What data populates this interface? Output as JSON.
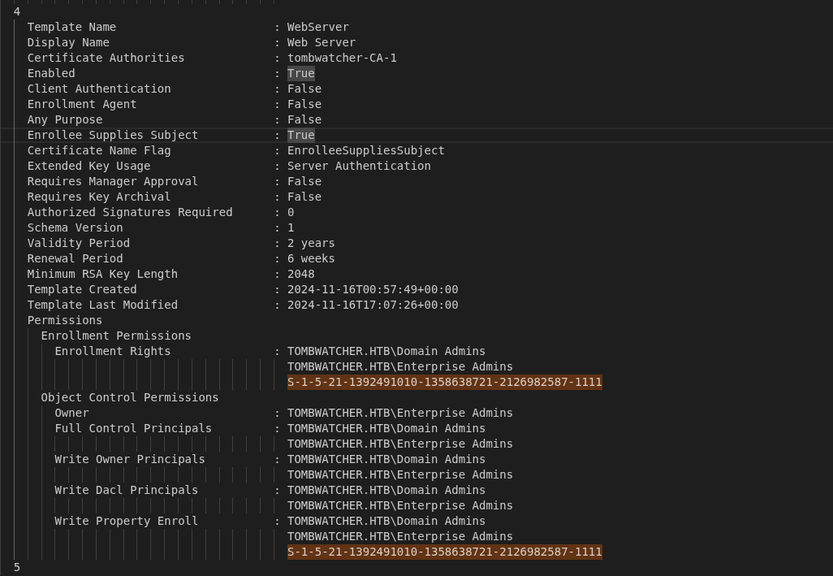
{
  "templates": [
    {
      "number": "4",
      "properties": [
        {
          "name": "Template Name",
          "separator": ":",
          "current_line": false,
          "values": [
            {
              "text": "WebServer",
              "occurrence_highlight": false,
              "search_match": false
            }
          ]
        },
        {
          "name": "Display Name",
          "separator": ":",
          "current_line": false,
          "values": [
            {
              "text": "Web Server",
              "occurrence_highlight": false,
              "search_match": false
            }
          ]
        },
        {
          "name": "Certificate Authorities",
          "separator": ":",
          "current_line": false,
          "values": [
            {
              "text": "tombwatcher-CA-1",
              "occurrence_highlight": false,
              "search_match": false
            }
          ]
        },
        {
          "name": "Enabled",
          "separator": ":",
          "current_line": false,
          "values": [
            {
              "text": "True",
              "occurrence_highlight": true,
              "search_match": false
            }
          ]
        },
        {
          "name": "Client Authentication",
          "separator": ":",
          "current_line": false,
          "values": [
            {
              "text": "False",
              "occurrence_highlight": false,
              "search_match": false
            }
          ]
        },
        {
          "name": "Enrollment Agent",
          "separator": ":",
          "current_line": false,
          "values": [
            {
              "text": "False",
              "occurrence_highlight": false,
              "search_match": false
            }
          ]
        },
        {
          "name": "Any Purpose",
          "separator": ":",
          "current_line": false,
          "values": [
            {
              "text": "False",
              "occurrence_highlight": false,
              "search_match": false
            }
          ]
        },
        {
          "name": "Enrollee Supplies Subject",
          "separator": ":",
          "current_line": true,
          "values": [
            {
              "text": "True",
              "occurrence_highlight": true,
              "search_match": false
            }
          ]
        },
        {
          "name": "Certificate Name Flag",
          "separator": ":",
          "current_line": false,
          "values": [
            {
              "text": "EnrolleeSuppliesSubject",
              "occurrence_highlight": false,
              "search_match": false
            }
          ]
        },
        {
          "name": "Extended Key Usage",
          "separator": ":",
          "current_line": false,
          "values": [
            {
              "text": "Server Authentication",
              "occurrence_highlight": false,
              "search_match": false
            }
          ]
        },
        {
          "name": "Requires Manager Approval",
          "separator": ":",
          "current_line": false,
          "values": [
            {
              "text": "False",
              "occurrence_highlight": false,
              "search_match": false
            }
          ]
        },
        {
          "name": "Requires Key Archival",
          "separator": ":",
          "current_line": false,
          "values": [
            {
              "text": "False",
              "occurrence_highlight": false,
              "search_match": false
            }
          ]
        },
        {
          "name": "Authorized Signatures Required",
          "separator": ":",
          "current_line": false,
          "values": [
            {
              "text": "0",
              "occurrence_highlight": false,
              "search_match": false
            }
          ]
        },
        {
          "name": "Schema Version",
          "separator": ":",
          "current_line": false,
          "values": [
            {
              "text": "1",
              "occurrence_highlight": false,
              "search_match": false
            }
          ]
        },
        {
          "name": "Validity Period",
          "separator": ":",
          "current_line": false,
          "values": [
            {
              "text": "2 years",
              "occurrence_highlight": false,
              "search_match": false
            }
          ]
        },
        {
          "name": "Renewal Period",
          "separator": ":",
          "current_line": false,
          "values": [
            {
              "text": "6 weeks",
              "occurrence_highlight": false,
              "search_match": false
            }
          ]
        },
        {
          "name": "Minimum RSA Key Length",
          "separator": ":",
          "current_line": false,
          "values": [
            {
              "text": "2048",
              "occurrence_highlight": false,
              "search_match": false
            }
          ]
        },
        {
          "name": "Template Created",
          "separator": ":",
          "current_line": false,
          "values": [
            {
              "text": "2024-11-16T00:57:49+00:00",
              "occurrence_highlight": false,
              "search_match": false
            }
          ]
        },
        {
          "name": "Template Last Modified",
          "separator": ":",
          "current_line": false,
          "values": [
            {
              "text": "2024-11-16T17:07:26+00:00",
              "occurrence_highlight": false,
              "search_match": false
            }
          ]
        },
        {
          "name": "Permissions",
          "current_line": false,
          "children": [
            {
              "name": "Enrollment Permissions",
              "current_line": false,
              "children": [
                {
                  "name": "Enrollment Rights",
                  "separator": ":",
                  "current_line": false,
                  "values": [
                    {
                      "text": "TOMBWATCHER.HTB\\Domain Admins",
                      "occurrence_highlight": false,
                      "search_match": false
                    },
                    {
                      "text": "TOMBWATCHER.HTB\\Enterprise Admins",
                      "occurrence_highlight": false,
                      "search_match": false
                    },
                    {
                      "text": "S-1-5-21-1392491010-1358638721-2126982587-1111",
                      "occurrence_highlight": false,
                      "search_match": true
                    }
                  ]
                }
              ]
            },
            {
              "name": "Object Control Permissions",
              "current_line": false,
              "children": [
                {
                  "name": "Owner",
                  "separator": ":",
                  "current_line": false,
                  "values": [
                    {
                      "text": "TOMBWATCHER.HTB\\Enterprise Admins",
                      "occurrence_highlight": false,
                      "search_match": false
                    }
                  ]
                },
                {
                  "name": "Full Control Principals",
                  "separator": ":",
                  "current_line": false,
                  "values": [
                    {
                      "text": "TOMBWATCHER.HTB\\Domain Admins",
                      "occurrence_highlight": false,
                      "search_match": false
                    },
                    {
                      "text": "TOMBWATCHER.HTB\\Enterprise Admins",
                      "occurrence_highlight": false,
                      "search_match": false
                    }
                  ]
                },
                {
                  "name": "Write Owner Principals",
                  "separator": ":",
                  "current_line": false,
                  "values": [
                    {
                      "text": "TOMBWATCHER.HTB\\Domain Admins",
                      "occurrence_highlight": false,
                      "search_match": false
                    },
                    {
                      "text": "TOMBWATCHER.HTB\\Enterprise Admins",
                      "occurrence_highlight": false,
                      "search_match": false
                    }
                  ]
                },
                {
                  "name": "Write Dacl Principals",
                  "separator": ":",
                  "current_line": false,
                  "values": [
                    {
                      "text": "TOMBWATCHER.HTB\\Domain Admins",
                      "occurrence_highlight": false,
                      "search_match": false
                    },
                    {
                      "text": "TOMBWATCHER.HTB\\Enterprise Admins",
                      "occurrence_highlight": false,
                      "search_match": false
                    }
                  ]
                },
                {
                  "name": "Write Property Enroll",
                  "separator": ":",
                  "current_line": false,
                  "values": [
                    {
                      "text": "TOMBWATCHER.HTB\\Domain Admins",
                      "occurrence_highlight": false,
                      "search_match": false
                    },
                    {
                      "text": "TOMBWATCHER.HTB\\Enterprise Admins",
                      "occurrence_highlight": false,
                      "search_match": false
                    },
                    {
                      "text": "S-1-5-21-1392491010-1358638721-2126982587-1111",
                      "occurrence_highlight": false,
                      "search_match": true
                    }
                  ]
                }
              ]
            }
          ]
        }
      ]
    },
    {
      "number": "5"
    }
  ]
}
